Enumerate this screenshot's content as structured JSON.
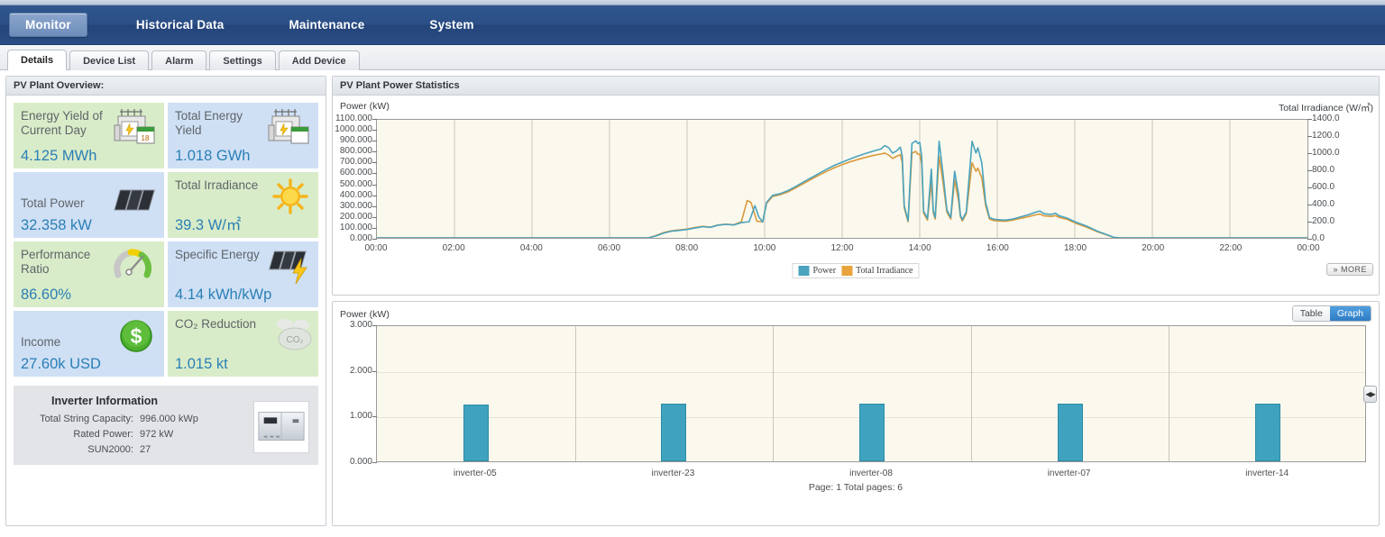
{
  "nav": {
    "items": [
      {
        "label": "Monitor",
        "active": true
      },
      {
        "label": "Historical Data",
        "active": false
      },
      {
        "label": "Maintenance",
        "active": false
      },
      {
        "label": "System",
        "active": false
      }
    ]
  },
  "subtabs": [
    {
      "label": "Details",
      "active": true
    },
    {
      "label": "Device List",
      "active": false
    },
    {
      "label": "Alarm",
      "active": false
    },
    {
      "label": "Settings",
      "active": false
    },
    {
      "label": "Add Device",
      "active": false
    }
  ],
  "overview": {
    "title": "PV Plant Overview:",
    "kpis": [
      {
        "label": "Energy Yield of Current Day",
        "value": "4.125 MWh",
        "tone": "green",
        "icon": "substation-calendar-icon"
      },
      {
        "label": "Total Energy Yield",
        "value": "1.018 GWh",
        "tone": "blue",
        "icon": "substation-calendar-icon"
      },
      {
        "label": "Total Power",
        "value": "32.358 kW",
        "tone": "blue",
        "icon": "solar-panel-icon"
      },
      {
        "label": "Total Irradiance",
        "value": "39.3 W/㎡",
        "tone": "green",
        "icon": "sun-icon"
      },
      {
        "label": "Performance Ratio",
        "value": "86.60%",
        "tone": "green",
        "icon": "gauge-icon"
      },
      {
        "label": "Specific Energy",
        "value": "4.14 kWh/kWp",
        "tone": "blue",
        "icon": "panel-bolt-icon"
      },
      {
        "label": "Income",
        "value": "27.60k USD",
        "tone": "blue",
        "icon": "dollar-coin-icon"
      },
      {
        "label": "CO₂ Reduction",
        "value": "1.015 kt",
        "tone": "green",
        "icon": "co2-cloud-icon"
      }
    ],
    "inverter": {
      "title": "Inverter Information",
      "rows": [
        {
          "key": "Total String Capacity:",
          "value": "996.000 kWp"
        },
        {
          "key": "Rated Power:",
          "value": "972 kW"
        },
        {
          "key": "SUN2000:",
          "value": "27"
        }
      ],
      "image_alt": "inverter-photo"
    }
  },
  "stats": {
    "title": "PV Plant Power Statistics",
    "more_label": "» MORE",
    "view_toggle": {
      "options": [
        "Table",
        "Graph"
      ],
      "selected": "Graph"
    },
    "pager": {
      "text": "Page: 1   Total pages: 6",
      "prev": "◀",
      "next": "▶"
    }
  },
  "colors": {
    "power": "#4aa3bd",
    "irradiance": "#d99a3c",
    "accent": "#2b7fb5",
    "nav_bg": "#2b4f86",
    "plot_bg": "#fbf9ee"
  },
  "chart_data": [
    {
      "type": "line",
      "title": "PV Plant Power Statistics",
      "ylabel": "Power (kW)",
      "y2label": "Total Irradiance  (W/㎡)",
      "xlabel": "",
      "grid": true,
      "legend_position": "bottom-center",
      "ylim": [
        0,
        1100
      ],
      "y2lim": [
        0,
        1400
      ],
      "yticks": [
        "0.000",
        "100.000",
        "200.000",
        "300.000",
        "400.000",
        "500.000",
        "600.000",
        "700.000",
        "800.000",
        "900.000",
        "1000.000",
        "1100.000"
      ],
      "y2ticks": [
        "0.0",
        "200.0",
        "400.0",
        "600.0",
        "800.0",
        "1000.0",
        "1200.0",
        "1400.0"
      ],
      "xticks": [
        "00:00",
        "02:00",
        "04:00",
        "06:00",
        "08:00",
        "10:00",
        "12:00",
        "14:00",
        "16:00",
        "18:00",
        "20:00",
        "22:00",
        "00:00"
      ],
      "x_hours": [
        0,
        24
      ],
      "series": [
        {
          "name": "Power",
          "color": "#4aa3bd",
          "unit": "kW",
          "points": [
            [
              0,
              0
            ],
            [
              7.0,
              0
            ],
            [
              7.2,
              18
            ],
            [
              7.4,
              45
            ],
            [
              7.6,
              62
            ],
            [
              7.8,
              70
            ],
            [
              8.0,
              78
            ],
            [
              8.2,
              92
            ],
            [
              8.4,
              104
            ],
            [
              8.6,
              98
            ],
            [
              8.8,
              118
            ],
            [
              9.0,
              126
            ],
            [
              9.2,
              120
            ],
            [
              9.4,
              142
            ],
            [
              9.6,
              150
            ],
            [
              9.75,
              300
            ],
            [
              9.85,
              195
            ],
            [
              9.95,
              148
            ],
            [
              10.05,
              330
            ],
            [
              10.2,
              395
            ],
            [
              10.4,
              412
            ],
            [
              10.6,
              440
            ],
            [
              10.8,
              478
            ],
            [
              11.0,
              520
            ],
            [
              11.2,
              560
            ],
            [
              11.4,
              600
            ],
            [
              11.6,
              640
            ],
            [
              11.8,
              676
            ],
            [
              12.0,
              705
            ],
            [
              12.2,
              735
            ],
            [
              12.4,
              762
            ],
            [
              12.6,
              786
            ],
            [
              12.8,
              808
            ],
            [
              13.0,
              828
            ],
            [
              13.1,
              860
            ],
            [
              13.2,
              840
            ],
            [
              13.3,
              790
            ],
            [
              13.4,
              810
            ],
            [
              13.5,
              845
            ],
            [
              13.55,
              760
            ],
            [
              13.6,
              300
            ],
            [
              13.7,
              160
            ],
            [
              13.8,
              880
            ],
            [
              13.9,
              905
            ],
            [
              13.95,
              880
            ],
            [
              14.0,
              890
            ],
            [
              14.05,
              760
            ],
            [
              14.1,
              250
            ],
            [
              14.2,
              180
            ],
            [
              14.3,
              640
            ],
            [
              14.35,
              250
            ],
            [
              14.4,
              190
            ],
            [
              14.5,
              900
            ],
            [
              14.6,
              600
            ],
            [
              14.7,
              260
            ],
            [
              14.8,
              190
            ],
            [
              14.9,
              620
            ],
            [
              15.0,
              410
            ],
            [
              15.05,
              210
            ],
            [
              15.1,
              170
            ],
            [
              15.2,
              240
            ],
            [
              15.35,
              900
            ],
            [
              15.45,
              790
            ],
            [
              15.5,
              840
            ],
            [
              15.6,
              700
            ],
            [
              15.7,
              330
            ],
            [
              15.8,
              190
            ],
            [
              15.9,
              175
            ],
            [
              16.0,
              170
            ],
            [
              16.2,
              165
            ],
            [
              16.4,
              175
            ],
            [
              16.6,
              195
            ],
            [
              16.8,
              215
            ],
            [
              17.0,
              240
            ],
            [
              17.1,
              250
            ],
            [
              17.2,
              225
            ],
            [
              17.4,
              218
            ],
            [
              17.5,
              230
            ],
            [
              17.6,
              205
            ],
            [
              17.8,
              185
            ],
            [
              18.0,
              150
            ],
            [
              18.3,
              110
            ],
            [
              18.6,
              60
            ],
            [
              18.9,
              20
            ],
            [
              19.0,
              5
            ],
            [
              19.2,
              0
            ],
            [
              24,
              0
            ]
          ]
        },
        {
          "name": "Total Irradiance",
          "color": "#d99a3c",
          "unit": "W/㎡",
          "points": [
            [
              0,
              0
            ],
            [
              7.0,
              0
            ],
            [
              7.2,
              22
            ],
            [
              7.4,
              50
            ],
            [
              7.6,
              66
            ],
            [
              7.8,
              74
            ],
            [
              8.0,
              82
            ],
            [
              8.2,
              96
            ],
            [
              8.4,
              108
            ],
            [
              8.6,
              100
            ],
            [
              8.8,
              120
            ],
            [
              9.0,
              128
            ],
            [
              9.2,
              122
            ],
            [
              9.4,
              150
            ],
            [
              9.55,
              348
            ],
            [
              9.65,
              330
            ],
            [
              9.8,
              155
            ],
            [
              9.95,
              150
            ],
            [
              10.05,
              320
            ],
            [
              10.2,
              385
            ],
            [
              10.4,
              402
            ],
            [
              10.6,
              428
            ],
            [
              10.8,
              466
            ],
            [
              11.0,
              505
            ],
            [
              11.2,
              545
            ],
            [
              11.4,
              584
            ],
            [
              11.6,
              620
            ],
            [
              11.8,
              654
            ],
            [
              12.0,
              682
            ],
            [
              12.2,
              708
            ],
            [
              12.4,
              730
            ],
            [
              12.6,
              750
            ],
            [
              12.8,
              768
            ],
            [
              13.0,
              782
            ],
            [
              13.1,
              790
            ],
            [
              13.2,
              772
            ],
            [
              13.3,
              740
            ],
            [
              13.4,
              760
            ],
            [
              13.5,
              775
            ],
            [
              13.55,
              700
            ],
            [
              13.6,
              280
            ],
            [
              13.7,
              150
            ],
            [
              13.8,
              790
            ],
            [
              13.9,
              805
            ],
            [
              13.95,
              780
            ],
            [
              14.0,
              780
            ],
            [
              14.05,
              690
            ],
            [
              14.1,
              230
            ],
            [
              14.2,
              165
            ],
            [
              14.3,
              520
            ],
            [
              14.35,
              230
            ],
            [
              14.4,
              175
            ],
            [
              14.5,
              760
            ],
            [
              14.6,
              520
            ],
            [
              14.7,
              240
            ],
            [
              14.8,
              175
            ],
            [
              14.9,
              540
            ],
            [
              15.0,
              350
            ],
            [
              15.05,
              195
            ],
            [
              15.1,
              158
            ],
            [
              15.2,
              225
            ],
            [
              15.35,
              700
            ],
            [
              15.45,
              620
            ],
            [
              15.5,
              650
            ],
            [
              15.6,
              560
            ],
            [
              15.7,
              300
            ],
            [
              15.8,
              175
            ],
            [
              15.9,
              162
            ],
            [
              16.0,
              158
            ],
            [
              16.2,
              155
            ],
            [
              16.4,
              165
            ],
            [
              16.6,
              182
            ],
            [
              16.8,
              198
            ],
            [
              17.0,
              215
            ],
            [
              17.1,
              222
            ],
            [
              17.2,
              205
            ],
            [
              17.4,
              200
            ],
            [
              17.5,
              208
            ],
            [
              17.6,
              190
            ],
            [
              17.8,
              172
            ],
            [
              18.0,
              140
            ],
            [
              18.3,
              100
            ],
            [
              18.6,
              55
            ],
            [
              18.9,
              18
            ],
            [
              19.0,
              4
            ],
            [
              19.2,
              0
            ],
            [
              24,
              0
            ]
          ]
        }
      ]
    },
    {
      "type": "bar",
      "ylabel": "Power (kW)",
      "categories": [
        "inverter-05",
        "inverter-23",
        "inverter-08",
        "inverter-07",
        "inverter-14"
      ],
      "values": [
        1.25,
        1.26,
        1.27,
        1.27,
        1.27
      ],
      "ylim": [
        0,
        3
      ],
      "yticks": [
        "0.000",
        "1.000",
        "2.000",
        "3.000"
      ],
      "grid": true,
      "series_color": "#3fa3bf"
    }
  ]
}
